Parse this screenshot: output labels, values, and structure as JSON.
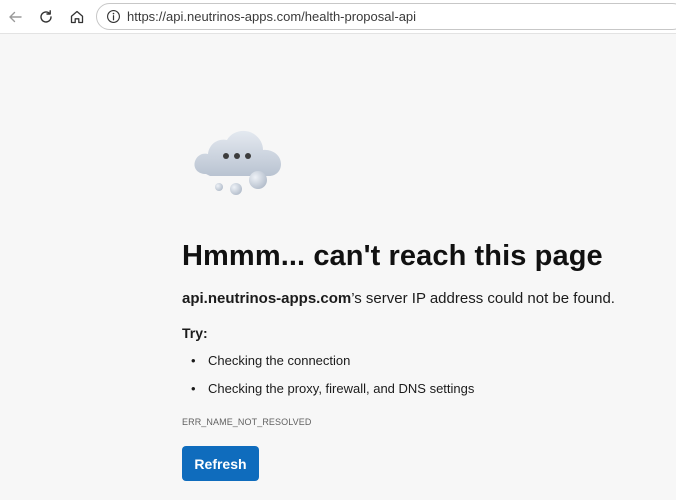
{
  "browser": {
    "url": "https://api.neutrinos-apps.com/health-proposal-api"
  },
  "icons": {
    "back": "back-arrow-icon",
    "reload": "reload-icon",
    "home": "home-icon",
    "site_info": "info-icon",
    "illustration": "cloud-icon"
  },
  "error_page": {
    "heading": "Hmmm... can't reach this page",
    "host": "api.neutrinos-apps.com",
    "description_suffix": "’s server IP address could not be found.",
    "try_label": "Try:",
    "tips": [
      "Checking the connection",
      "Checking the proxy, firewall, and DNS settings"
    ],
    "bullet": "•",
    "error_code": "ERR_NAME_NOT_RESOLVED",
    "refresh_label": "Refresh"
  },
  "colors": {
    "accent": "#0f6cbd",
    "page_background": "#f7f7f7"
  }
}
